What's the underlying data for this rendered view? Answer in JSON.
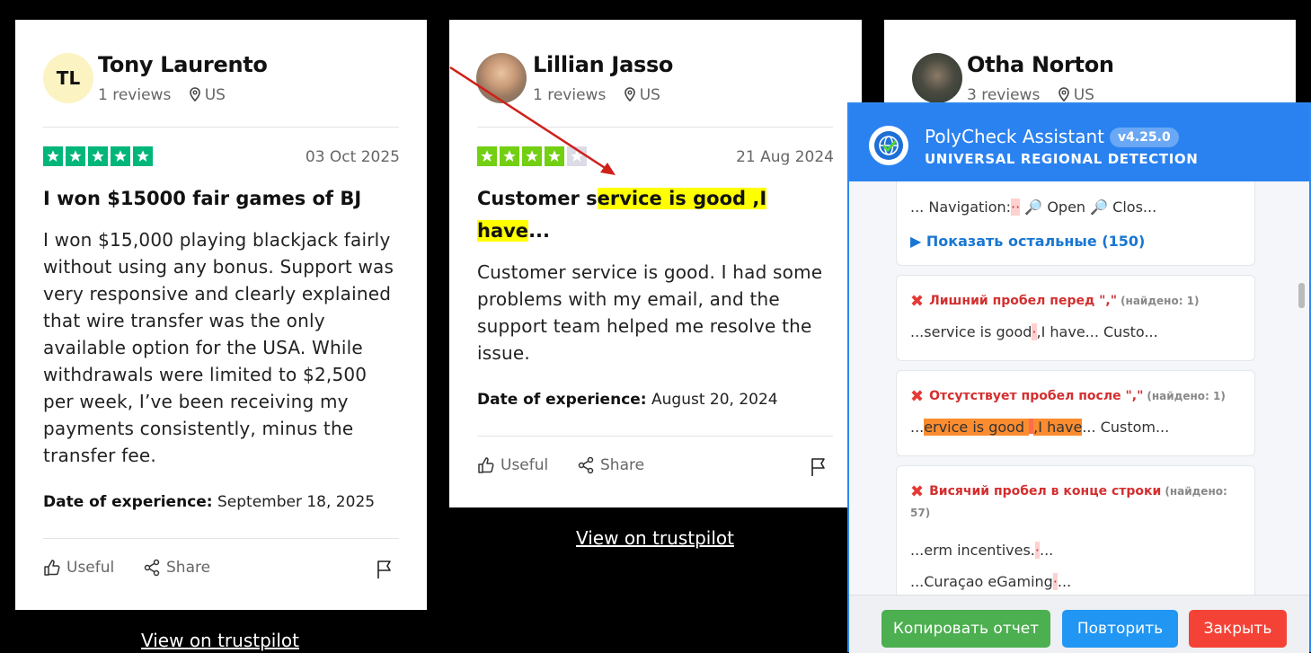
{
  "reviews": [
    {
      "initials": "TL",
      "name": "Tony Laurento",
      "reviews_count": "1 reviews",
      "country": "US",
      "rating": 5,
      "date": "03 Oct 2025",
      "title": "I won $15000 fair games of BJ",
      "body": "I won $15,000 playing blackjack fairly without using any bonus. Support was very responsive and clearly explained that wire transfer was the only available option for the USA. While withdrawals were limited to $2,500 per week, I’ve been receiving my payments consistently, minus the transfer fee.",
      "exp_label": "Date of experience:",
      "exp_date": "September 18, 2025",
      "useful": "Useful",
      "share": "Share",
      "link": "View on trustpilot"
    },
    {
      "name": "Lillian Jasso",
      "reviews_count": "1 reviews",
      "country": "US",
      "rating": 4,
      "date": "21 Aug 2024",
      "title_pre": "Customer s",
      "title_hl1": "ervice is good ,I",
      "title_hl2": "have",
      "title_post": "...",
      "body": "Customer service is good. I had some problems with my email, and the support team helped me resolve the issue.",
      "exp_label": "Date of experience:",
      "exp_date": "August 20, 2024",
      "useful": "Useful",
      "share": "Share",
      "link": "View on trustpilot"
    },
    {
      "name": "Otha Norton",
      "reviews_count": "3 reviews",
      "country": "US"
    }
  ],
  "colors": {
    "star_full": "#00b67a",
    "star_four": "#73cf11",
    "star_empty": "#dcdce6",
    "highlight": "#ffff00",
    "panel_header": "#2a82f0"
  },
  "panel": {
    "title": "PolyCheck Assistant",
    "version": "v4.25.0",
    "subtitle": "UNIVERSAL REGIONAL DETECTION",
    "nav_pre": "... Navigation:",
    "nav_mark": "··",
    "nav_open": "Open",
    "nav_close": "Clos...",
    "show_more": "▶ Показать остальные (150)",
    "issues": [
      {
        "title": "Лишний пробел перед \",\"",
        "found": "(найдено: 1)",
        "pre": "...service is good",
        "mark": "·",
        "post": ",I have... Custo..."
      },
      {
        "title": "Отсутствует пробел после \",\"",
        "found": "(найдено: 1)",
        "pre": "...",
        "hl_a": "ervice is good ",
        "mark": "",
        "hl_b": ",I have",
        "post": "... Custom..."
      },
      {
        "title": "Висячий пробел в конце строки",
        "found_a": "(найдено:",
        "found_b": "57)",
        "line1_pre": "...erm incentives.",
        "line1_mark": "·",
        "line1_post": "...",
        "line2_pre": "...Curaçao eGaming",
        "line2_mark": "·",
        "line2_post": "..."
      }
    ],
    "buttons": {
      "copy": "Копировать отчет",
      "retry": "Повторить",
      "close": "Закрыть"
    }
  }
}
